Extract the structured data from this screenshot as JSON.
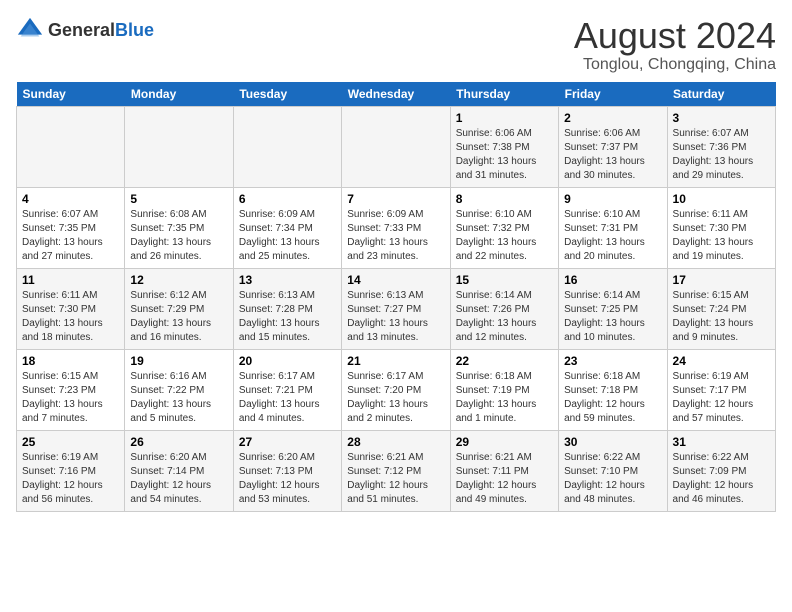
{
  "logo": {
    "general": "General",
    "blue": "Blue"
  },
  "title": "August 2024",
  "subtitle": "Tonglou, Chongqing, China",
  "days_of_week": [
    "Sunday",
    "Monday",
    "Tuesday",
    "Wednesday",
    "Thursday",
    "Friday",
    "Saturday"
  ],
  "weeks": [
    [
      {
        "day": "",
        "info": ""
      },
      {
        "day": "",
        "info": ""
      },
      {
        "day": "",
        "info": ""
      },
      {
        "day": "",
        "info": ""
      },
      {
        "day": "1",
        "info": "Sunrise: 6:06 AM\nSunset: 7:38 PM\nDaylight: 13 hours and 31 minutes."
      },
      {
        "day": "2",
        "info": "Sunrise: 6:06 AM\nSunset: 7:37 PM\nDaylight: 13 hours and 30 minutes."
      },
      {
        "day": "3",
        "info": "Sunrise: 6:07 AM\nSunset: 7:36 PM\nDaylight: 13 hours and 29 minutes."
      }
    ],
    [
      {
        "day": "4",
        "info": "Sunrise: 6:07 AM\nSunset: 7:35 PM\nDaylight: 13 hours and 27 minutes."
      },
      {
        "day": "5",
        "info": "Sunrise: 6:08 AM\nSunset: 7:35 PM\nDaylight: 13 hours and 26 minutes."
      },
      {
        "day": "6",
        "info": "Sunrise: 6:09 AM\nSunset: 7:34 PM\nDaylight: 13 hours and 25 minutes."
      },
      {
        "day": "7",
        "info": "Sunrise: 6:09 AM\nSunset: 7:33 PM\nDaylight: 13 hours and 23 minutes."
      },
      {
        "day": "8",
        "info": "Sunrise: 6:10 AM\nSunset: 7:32 PM\nDaylight: 13 hours and 22 minutes."
      },
      {
        "day": "9",
        "info": "Sunrise: 6:10 AM\nSunset: 7:31 PM\nDaylight: 13 hours and 20 minutes."
      },
      {
        "day": "10",
        "info": "Sunrise: 6:11 AM\nSunset: 7:30 PM\nDaylight: 13 hours and 19 minutes."
      }
    ],
    [
      {
        "day": "11",
        "info": "Sunrise: 6:11 AM\nSunset: 7:30 PM\nDaylight: 13 hours and 18 minutes."
      },
      {
        "day": "12",
        "info": "Sunrise: 6:12 AM\nSunset: 7:29 PM\nDaylight: 13 hours and 16 minutes."
      },
      {
        "day": "13",
        "info": "Sunrise: 6:13 AM\nSunset: 7:28 PM\nDaylight: 13 hours and 15 minutes."
      },
      {
        "day": "14",
        "info": "Sunrise: 6:13 AM\nSunset: 7:27 PM\nDaylight: 13 hours and 13 minutes."
      },
      {
        "day": "15",
        "info": "Sunrise: 6:14 AM\nSunset: 7:26 PM\nDaylight: 13 hours and 12 minutes."
      },
      {
        "day": "16",
        "info": "Sunrise: 6:14 AM\nSunset: 7:25 PM\nDaylight: 13 hours and 10 minutes."
      },
      {
        "day": "17",
        "info": "Sunrise: 6:15 AM\nSunset: 7:24 PM\nDaylight: 13 hours and 9 minutes."
      }
    ],
    [
      {
        "day": "18",
        "info": "Sunrise: 6:15 AM\nSunset: 7:23 PM\nDaylight: 13 hours and 7 minutes."
      },
      {
        "day": "19",
        "info": "Sunrise: 6:16 AM\nSunset: 7:22 PM\nDaylight: 13 hours and 5 minutes."
      },
      {
        "day": "20",
        "info": "Sunrise: 6:17 AM\nSunset: 7:21 PM\nDaylight: 13 hours and 4 minutes."
      },
      {
        "day": "21",
        "info": "Sunrise: 6:17 AM\nSunset: 7:20 PM\nDaylight: 13 hours and 2 minutes."
      },
      {
        "day": "22",
        "info": "Sunrise: 6:18 AM\nSunset: 7:19 PM\nDaylight: 13 hours and 1 minute."
      },
      {
        "day": "23",
        "info": "Sunrise: 6:18 AM\nSunset: 7:18 PM\nDaylight: 12 hours and 59 minutes."
      },
      {
        "day": "24",
        "info": "Sunrise: 6:19 AM\nSunset: 7:17 PM\nDaylight: 12 hours and 57 minutes."
      }
    ],
    [
      {
        "day": "25",
        "info": "Sunrise: 6:19 AM\nSunset: 7:16 PM\nDaylight: 12 hours and 56 minutes."
      },
      {
        "day": "26",
        "info": "Sunrise: 6:20 AM\nSunset: 7:14 PM\nDaylight: 12 hours and 54 minutes."
      },
      {
        "day": "27",
        "info": "Sunrise: 6:20 AM\nSunset: 7:13 PM\nDaylight: 12 hours and 53 minutes."
      },
      {
        "day": "28",
        "info": "Sunrise: 6:21 AM\nSunset: 7:12 PM\nDaylight: 12 hours and 51 minutes."
      },
      {
        "day": "29",
        "info": "Sunrise: 6:21 AM\nSunset: 7:11 PM\nDaylight: 12 hours and 49 minutes."
      },
      {
        "day": "30",
        "info": "Sunrise: 6:22 AM\nSunset: 7:10 PM\nDaylight: 12 hours and 48 minutes."
      },
      {
        "day": "31",
        "info": "Sunrise: 6:22 AM\nSunset: 7:09 PM\nDaylight: 12 hours and 46 minutes."
      }
    ]
  ]
}
